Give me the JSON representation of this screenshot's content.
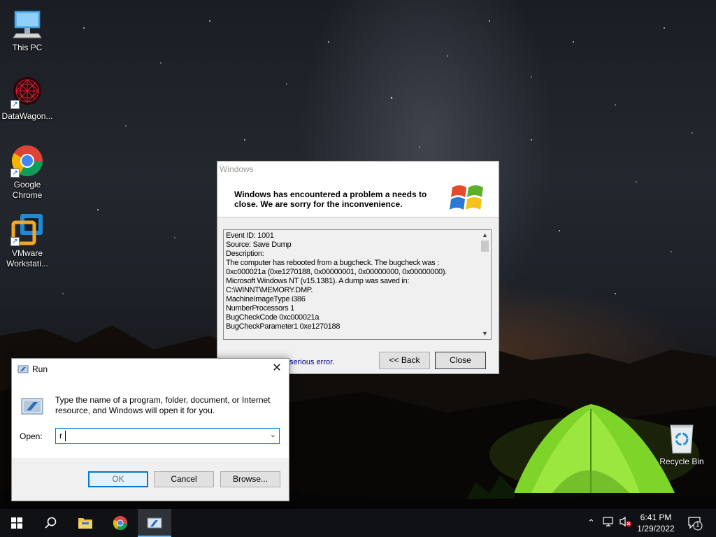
{
  "desktop_icons": [
    {
      "label": "This PC",
      "icon": "this-pc-icon"
    },
    {
      "label": "DataWagon...",
      "icon": "datawagon-icon"
    },
    {
      "label": "Google Chrome",
      "icon": "chrome-icon"
    },
    {
      "label": "VMware Workstati...",
      "icon": "vmware-icon"
    },
    {
      "label": "Recycle Bin",
      "icon": "recycle-bin-icon"
    }
  ],
  "error_dialog": {
    "title": "Windows",
    "header": "Windows has encountered a problem a needs to close. We are sorry for the inconvenience.",
    "lines": [
      "Event ID: 1001",
      "Source: Save Dump",
      "Description:",
      "The computer has rebooted from a bugcheck. The bugcheck was :",
      "0xc000021a (0xe1270188, 0x00000001, 0x00000000, 0x00000000).",
      "Microsoft Windows NT (v15.1381). A dump was saved in:",
      "C:\\WINNT\\MEMORY.DMP.",
      "MachineImageType i386",
      "NumberProcessors 1",
      "BugCheckCode 0xc000021a",
      "BugCheckParameter1 0xe1270188"
    ],
    "status": "serious error.",
    "back_label": "<< Back",
    "close_label": "Close"
  },
  "run_dialog": {
    "title": "Run",
    "close_glyph": "✕",
    "description": "Type the name of a program, folder, document, or Internet resource, and Windows will open it for you.",
    "open_label": "Open:",
    "open_value": "r",
    "ok_label": "OK",
    "cancel_label": "Cancel",
    "browse_label": "Browse..."
  },
  "taskbar": {
    "time": "6:41 PM",
    "date": "1/29/2022",
    "notification_count": "1",
    "pinned": [
      "start-icon",
      "search-icon",
      "file-explorer-icon",
      "chrome-icon",
      "run-icon"
    ],
    "active": "run-icon"
  },
  "colors": {
    "accent": "#0078d7",
    "taskbar": "#0f1114",
    "dialog_face": "#f0f0f0",
    "status_link": "#00008b"
  }
}
